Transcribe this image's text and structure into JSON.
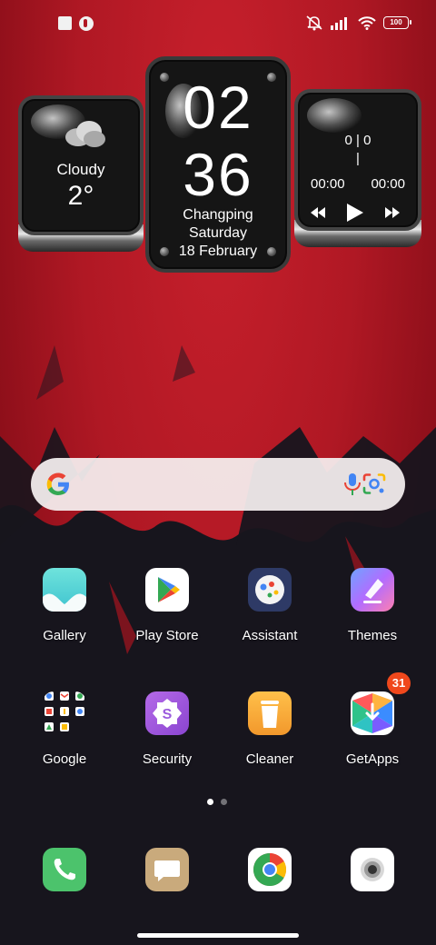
{
  "status_bar": {
    "battery": "100"
  },
  "weather_widget": {
    "condition": "Cloudy",
    "temperature": "2°"
  },
  "clock_widget": {
    "hours": "02",
    "minutes": "36",
    "location": "Changping",
    "weekday": "Saturday",
    "date": "18 February"
  },
  "music_widget": {
    "track_count": "0 | 0",
    "divider": "|",
    "elapsed": "00:00",
    "duration": "00:00"
  },
  "apps_row1": [
    {
      "label": "Gallery",
      "icon": "gallery-icon",
      "color": "#4fd6d0"
    },
    {
      "label": "Play Store",
      "icon": "play-store-icon",
      "color": "#ffffff"
    },
    {
      "label": "Assistant",
      "icon": "assistant-icon",
      "color": "#2e3a66"
    },
    {
      "label": "Themes",
      "icon": "themes-icon",
      "color": "#9b6bff"
    }
  ],
  "apps_row2": [
    {
      "label": "Google",
      "icon": "google-folder-icon",
      "color": "transparent"
    },
    {
      "label": "Security",
      "icon": "security-icon",
      "color": "#9b5bdd"
    },
    {
      "label": "Cleaner",
      "icon": "cleaner-icon",
      "color": "#f5a43a"
    },
    {
      "label": "GetApps",
      "icon": "getapps-icon",
      "color": "#ffffff"
    }
  ],
  "getapps_badge": "31",
  "dock": [
    {
      "icon": "phone-icon",
      "color": "#4cc36c"
    },
    {
      "icon": "messages-icon",
      "color": "#c9aa7c"
    },
    {
      "icon": "chrome-icon",
      "color": "#ffffff"
    },
    {
      "icon": "camera-icon",
      "color": "#ffffff"
    }
  ],
  "page_indicator": {
    "pages": 2,
    "current": 1
  }
}
